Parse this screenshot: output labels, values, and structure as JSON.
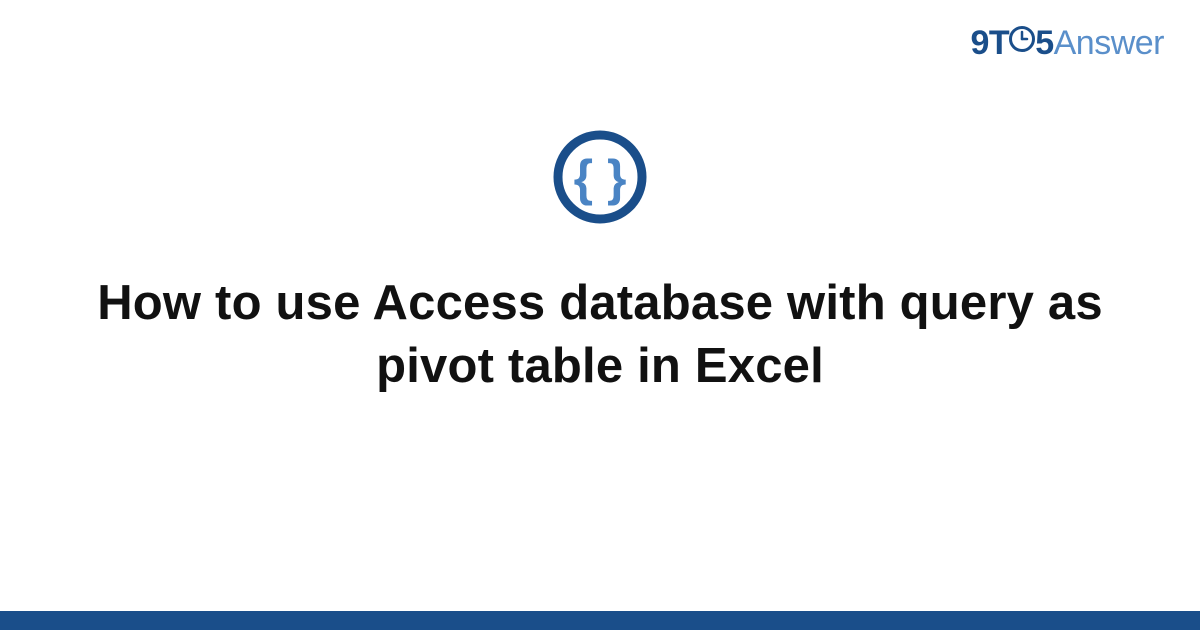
{
  "logo": {
    "part1": "9T",
    "part2": "5",
    "part3": "Answer"
  },
  "title": "How to use Access database with query as pivot table in Excel",
  "colors": {
    "primary_dark": "#1a4e8a",
    "primary_light": "#5a8fca",
    "accent_brace": "#4a84c4"
  }
}
